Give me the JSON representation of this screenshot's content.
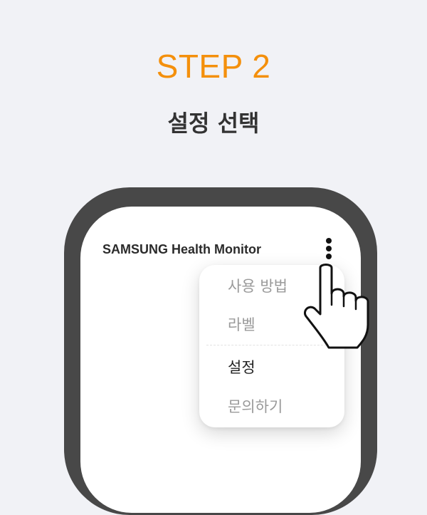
{
  "step_label": "STEP 2",
  "title": "설정 선택",
  "app": {
    "title": "SAMSUNG Health Monitor"
  },
  "menu": {
    "items": [
      {
        "label": "사용 방법"
      },
      {
        "label": "라벨"
      },
      {
        "label": "설정",
        "selected": true
      },
      {
        "label": "문의하기"
      }
    ]
  },
  "colors": {
    "accent": "#f4900c",
    "background": "#f1f2f6",
    "phone_frame": "#484848",
    "menu_text": "#9a9a9a",
    "menu_text_selected": "#222222"
  },
  "icons": {
    "more": "more-vertical-icon",
    "pointer": "pointing-hand-icon"
  }
}
